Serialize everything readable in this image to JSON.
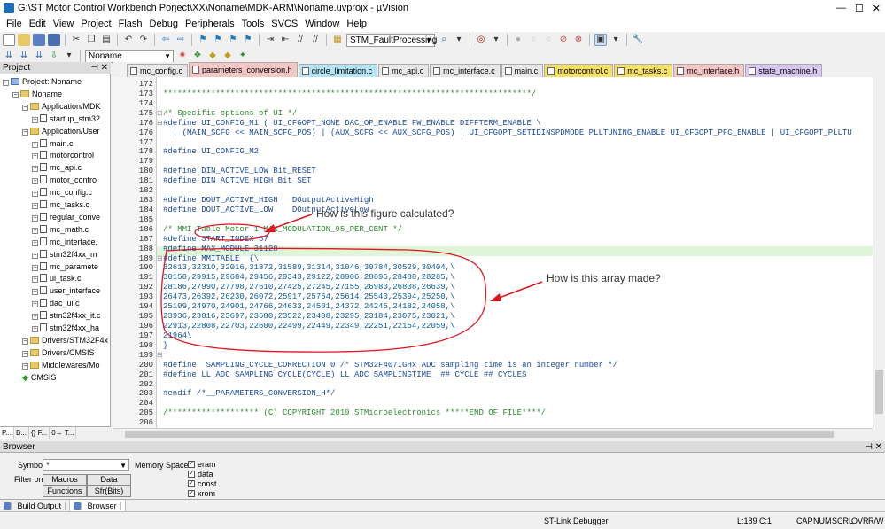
{
  "window": {
    "title": "G:\\ST Motor Control Workbench Porject\\XX\\Noname\\MDK-ARM\\Noname.uvprojx - µVision"
  },
  "menu": [
    "File",
    "Edit",
    "View",
    "Project",
    "Flash",
    "Debug",
    "Peripherals",
    "Tools",
    "SVCS",
    "Window",
    "Help"
  ],
  "toolbar": {
    "target": "STM_FaultProcessing",
    "project_target": "Noname"
  },
  "project": {
    "header": "Project",
    "tree": [
      {
        "label": "Project: Noname",
        "type": "root",
        "indent": 0
      },
      {
        "label": "Noname",
        "type": "folder",
        "indent": 1
      },
      {
        "label": "Application/MDK",
        "type": "folder",
        "indent": 2
      },
      {
        "label": "startup_stm32",
        "type": "file",
        "indent": 3
      },
      {
        "label": "Application/User",
        "type": "folder",
        "indent": 2
      },
      {
        "label": "main.c",
        "type": "file",
        "indent": 3
      },
      {
        "label": "motorcontrol",
        "type": "file",
        "indent": 3
      },
      {
        "label": "mc_api.c",
        "type": "file",
        "indent": 3
      },
      {
        "label": "motor_contro",
        "type": "file",
        "indent": 3
      },
      {
        "label": "mc_config.c",
        "type": "file",
        "indent": 3
      },
      {
        "label": "mc_tasks.c",
        "type": "file",
        "indent": 3
      },
      {
        "label": "regular_conve",
        "type": "file",
        "indent": 3
      },
      {
        "label": "mc_math.c",
        "type": "file",
        "indent": 3
      },
      {
        "label": "mc_interface.",
        "type": "file",
        "indent": 3
      },
      {
        "label": "stm32f4xx_m",
        "type": "file",
        "indent": 3
      },
      {
        "label": "mc_paramete",
        "type": "file",
        "indent": 3
      },
      {
        "label": "ui_task.c",
        "type": "file",
        "indent": 3
      },
      {
        "label": "user_interface",
        "type": "file",
        "indent": 3
      },
      {
        "label": "dac_ui.c",
        "type": "file",
        "indent": 3
      },
      {
        "label": "stm32f4xx_it.c",
        "type": "file",
        "indent": 3
      },
      {
        "label": "stm32f4xx_ha",
        "type": "file",
        "indent": 3
      },
      {
        "label": "Drivers/STM32F4x",
        "type": "folder",
        "indent": 2
      },
      {
        "label": "Drivers/CMSIS",
        "type": "folder",
        "indent": 2
      },
      {
        "label": "Middlewares/Mo",
        "type": "folder",
        "indent": 2
      },
      {
        "label": "CMSIS",
        "type": "gem",
        "indent": 2
      }
    ],
    "tabs": [
      "P...",
      "B...",
      "{} F...",
      "0→ T..."
    ]
  },
  "editor_tabs": [
    {
      "label": "mc_config.c",
      "color": "#e8e8e8"
    },
    {
      "label": "parameters_conversion.h",
      "color": "#f4c6c6",
      "active": true
    },
    {
      "label": "circle_limitation.c",
      "color": "#b5e5f3"
    },
    {
      "label": "mc_api.c",
      "color": "#e8e8e8"
    },
    {
      "label": "mc_interface.c",
      "color": "#e8e8e8"
    },
    {
      "label": "main.c",
      "color": "#e8e8e8"
    },
    {
      "label": "motorcontrol.c",
      "color": "#f5e06a"
    },
    {
      "label": "mc_tasks.c",
      "color": "#f5e06a"
    },
    {
      "label": "mc_interface.h",
      "color": "#f4c6c6"
    },
    {
      "label": "state_machine.h",
      "color": "#d8c8f0"
    }
  ],
  "code": [
    {
      "n": "172",
      "t": "",
      "k": ""
    },
    {
      "n": "173",
      "t": "*****************************************************************************/",
      "k": "comment"
    },
    {
      "n": "174",
      "t": "",
      "k": ""
    },
    {
      "n": "175",
      "t": "/* Specific options of UI */",
      "k": "comment"
    },
    {
      "n": "176",
      "t": "#define UI_CONFIG_M1 ( UI_CFGOPT_NONE DAC_OP_ENABLE FW_ENABLE DIFFTERM_ENABLE \\",
      "k": ""
    },
    {
      "n": "176",
      "t": "  | (MAIN_SCFG << MAIN_SCFG_POS) | (AUX_SCFG << AUX_SCFG_POS) | UI_CFGOPT_SETIDINSPDMODE PLLTUNING_ENABLE UI_CFGOPT_PFC_ENABLE | UI_CFGOPT_PLLTU",
      "k": ""
    },
    {
      "n": "177",
      "t": "",
      "k": ""
    },
    {
      "n": "178",
      "t": "#define UI_CONFIG_M2",
      "k": ""
    },
    {
      "n": "179",
      "t": "",
      "k": ""
    },
    {
      "n": "180",
      "t": "#define DIN_ACTIVE_LOW Bit_RESET",
      "k": ""
    },
    {
      "n": "181",
      "t": "#define DIN_ACTIVE_HIGH Bit_SET",
      "k": ""
    },
    {
      "n": "182",
      "t": "",
      "k": ""
    },
    {
      "n": "183",
      "t": "#define DOUT_ACTIVE_HIGH   DOutputActiveHigh",
      "k": ""
    },
    {
      "n": "184",
      "t": "#define DOUT_ACTIVE_LOW    DOutputActiveLow",
      "k": ""
    },
    {
      "n": "185",
      "t": "",
      "k": ""
    },
    {
      "n": "186",
      "t": "/* MMI Table Motor 1 MAX_MODULATION_95_PER_CENT */",
      "k": "comment"
    },
    {
      "n": "187",
      "t": "#define START_INDEX 57",
      "k": ""
    },
    {
      "n": "188",
      "t": "#define MAX_MODULE 31128",
      "k": ""
    },
    {
      "n": "189",
      "t": "#define MMITABLE  {\\",
      "k": ""
    },
    {
      "n": "190",
      "t": "32613,32310,32016,31872,31589,31314,31046,30784,30529,30404,\\",
      "k": "data"
    },
    {
      "n": "191",
      "t": "30158,29915,29684,29456,29343,29122,28906,28695,28488,28285,\\",
      "k": "data"
    },
    {
      "n": "192",
      "t": "28186,27990,27798,27610,27425,27245,27155,26980,26808,26639,\\",
      "k": "data"
    },
    {
      "n": "193",
      "t": "26473,26392,26230,26072,25917,25764,25614,25540,25394,25250,\\",
      "k": "data"
    },
    {
      "n": "194",
      "t": "25109,24970,24901,24766,24633,24501,24372,24245,24182,24058,\\",
      "k": "data"
    },
    {
      "n": "195",
      "t": "23936,23816,23697,23580,23522,23408,23295,23184,23075,23021,\\",
      "k": "data"
    },
    {
      "n": "196",
      "t": "22913,22808,22703,22600,22499,22449,22349,22251,22154,22059,\\",
      "k": "data"
    },
    {
      "n": "197",
      "t": "21964\\",
      "k": "data"
    },
    {
      "n": "198",
      "t": "}",
      "k": ""
    },
    {
      "n": "199",
      "t": "",
      "k": ""
    },
    {
      "n": "200",
      "t": "#define  SAMPLING_CYCLE_CORRECTION 0 /* STM32F407IGHx ADC sampling time is an integer number */",
      "k": ""
    },
    {
      "n": "201",
      "t": "#define LL_ADC_SAMPLING_CYCLE(CYCLE) LL_ADC_SAMPLINGTIME_ ## CYCLE ## CYCLES",
      "k": ""
    },
    {
      "n": "202",
      "t": "",
      "k": ""
    },
    {
      "n": "203",
      "t": "#endif /*__PARAMETERS_CONVERSION_H*/",
      "k": ""
    },
    {
      "n": "204",
      "t": "",
      "k": ""
    },
    {
      "n": "205",
      "t": "/******************* (C) COPYRIGHT 2019 STMicroelectronics *****END OF FILE****/",
      "k": "comment"
    },
    {
      "n": "206",
      "t": "",
      "k": ""
    }
  ],
  "annotations": {
    "q1": "How is this figure calculated?",
    "q2": "How is this array made?"
  },
  "browser": {
    "header": "Browser",
    "symbol_label": "Symbol:",
    "symbol_value": "*",
    "filter_label": "Filter on:",
    "buttons": [
      "Macros",
      "Data",
      "Functions",
      "Sfr(Bits)"
    ],
    "memory_label": "Memory Spaces:",
    "memory": [
      "eram",
      "data",
      "const",
      "xrom"
    ]
  },
  "bottom_tabs": [
    "Build Output",
    "Browser"
  ],
  "status": {
    "debugger": "ST-Link Debugger",
    "position": "L:189 C:1",
    "flags": [
      "CAP",
      "NUM",
      "SCRL",
      "OVR",
      "R/W"
    ]
  },
  "colors": {
    "annotation_red": "#e0141e",
    "highlight": "#dff5d8"
  }
}
